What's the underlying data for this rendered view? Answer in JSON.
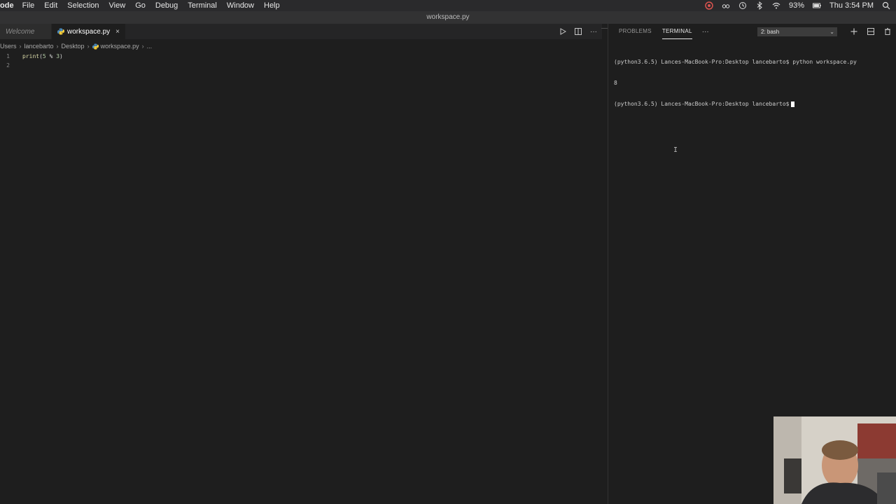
{
  "menubar": {
    "app_name": "ode",
    "items": [
      "File",
      "Edit",
      "Selection",
      "View",
      "Go",
      "Debug",
      "Terminal",
      "Window",
      "Help"
    ],
    "battery": "93%",
    "clock": "Thu 3:54 PM"
  },
  "window": {
    "title": "workspace.py"
  },
  "tabs": [
    {
      "label": "Welcome"
    },
    {
      "label": "workspace.py",
      "close": "×"
    }
  ],
  "breadcrumbs": {
    "items": [
      "Users",
      "lancebarto",
      "Desktop",
      "workspace.py",
      "..."
    ],
    "separator": "›"
  },
  "code": {
    "lines": [
      {
        "no": "1",
        "fn": "print",
        "open": "(",
        "a": "5",
        "op": " % ",
        "b": "3",
        "close": ")"
      },
      {
        "no": "2"
      }
    ]
  },
  "panel": {
    "tabs": [
      "PROBLEMS",
      "TERMINAL"
    ],
    "more": "···",
    "terminal_select": "2: bash",
    "terminal_lines": [
      "(python3.6.5) Lances-MacBook-Pro:Desktop lancebarto$ python workspace.py",
      "8",
      "(python3.6.5) Lances-MacBook-Pro:Desktop lancebarto$"
    ]
  },
  "editor_actions": {
    "more": "···"
  },
  "colors": {
    "editor_bg": "#1e1e1e",
    "tab_bar_bg": "#252526",
    "menubar_bg": "#2a2a2c",
    "accent_fn": "#dcdcaa",
    "accent_num": "#b5cea8"
  }
}
